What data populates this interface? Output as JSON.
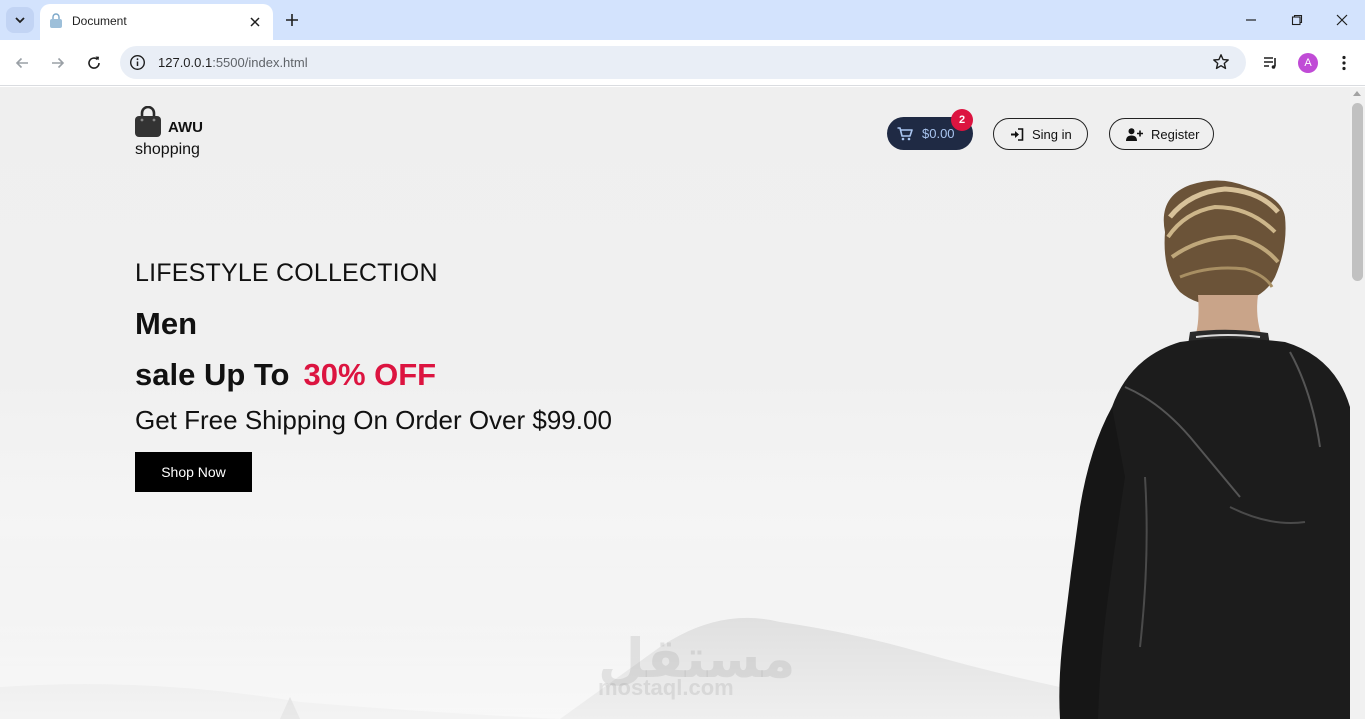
{
  "browser": {
    "tab_title": "Document",
    "url_host": "127.0.0.1",
    "url_rest": ":5500/index.html",
    "profile_initial": "A"
  },
  "site": {
    "logo_brand": "AWU",
    "logo_sub": "shopping",
    "cart_amount": "$0.00",
    "cart_count": "2",
    "signin_label": "Sing in",
    "register_label": "Register"
  },
  "hero": {
    "kicker": "LIFESTYLE COLLECTION",
    "headline": "Men",
    "sale_prefix": "sale Up To",
    "sale_highlight": "30% OFF",
    "shipping": "Get Free Shipping On Order Over $99.00",
    "cta_label": "Shop Now"
  },
  "watermark": {
    "arabic": "مستقل",
    "latin": "mostaql.com"
  },
  "colors": {
    "accent": "#dc1440",
    "cart_bg": "#1f2a44",
    "tabbar": "#d3e3fd"
  }
}
